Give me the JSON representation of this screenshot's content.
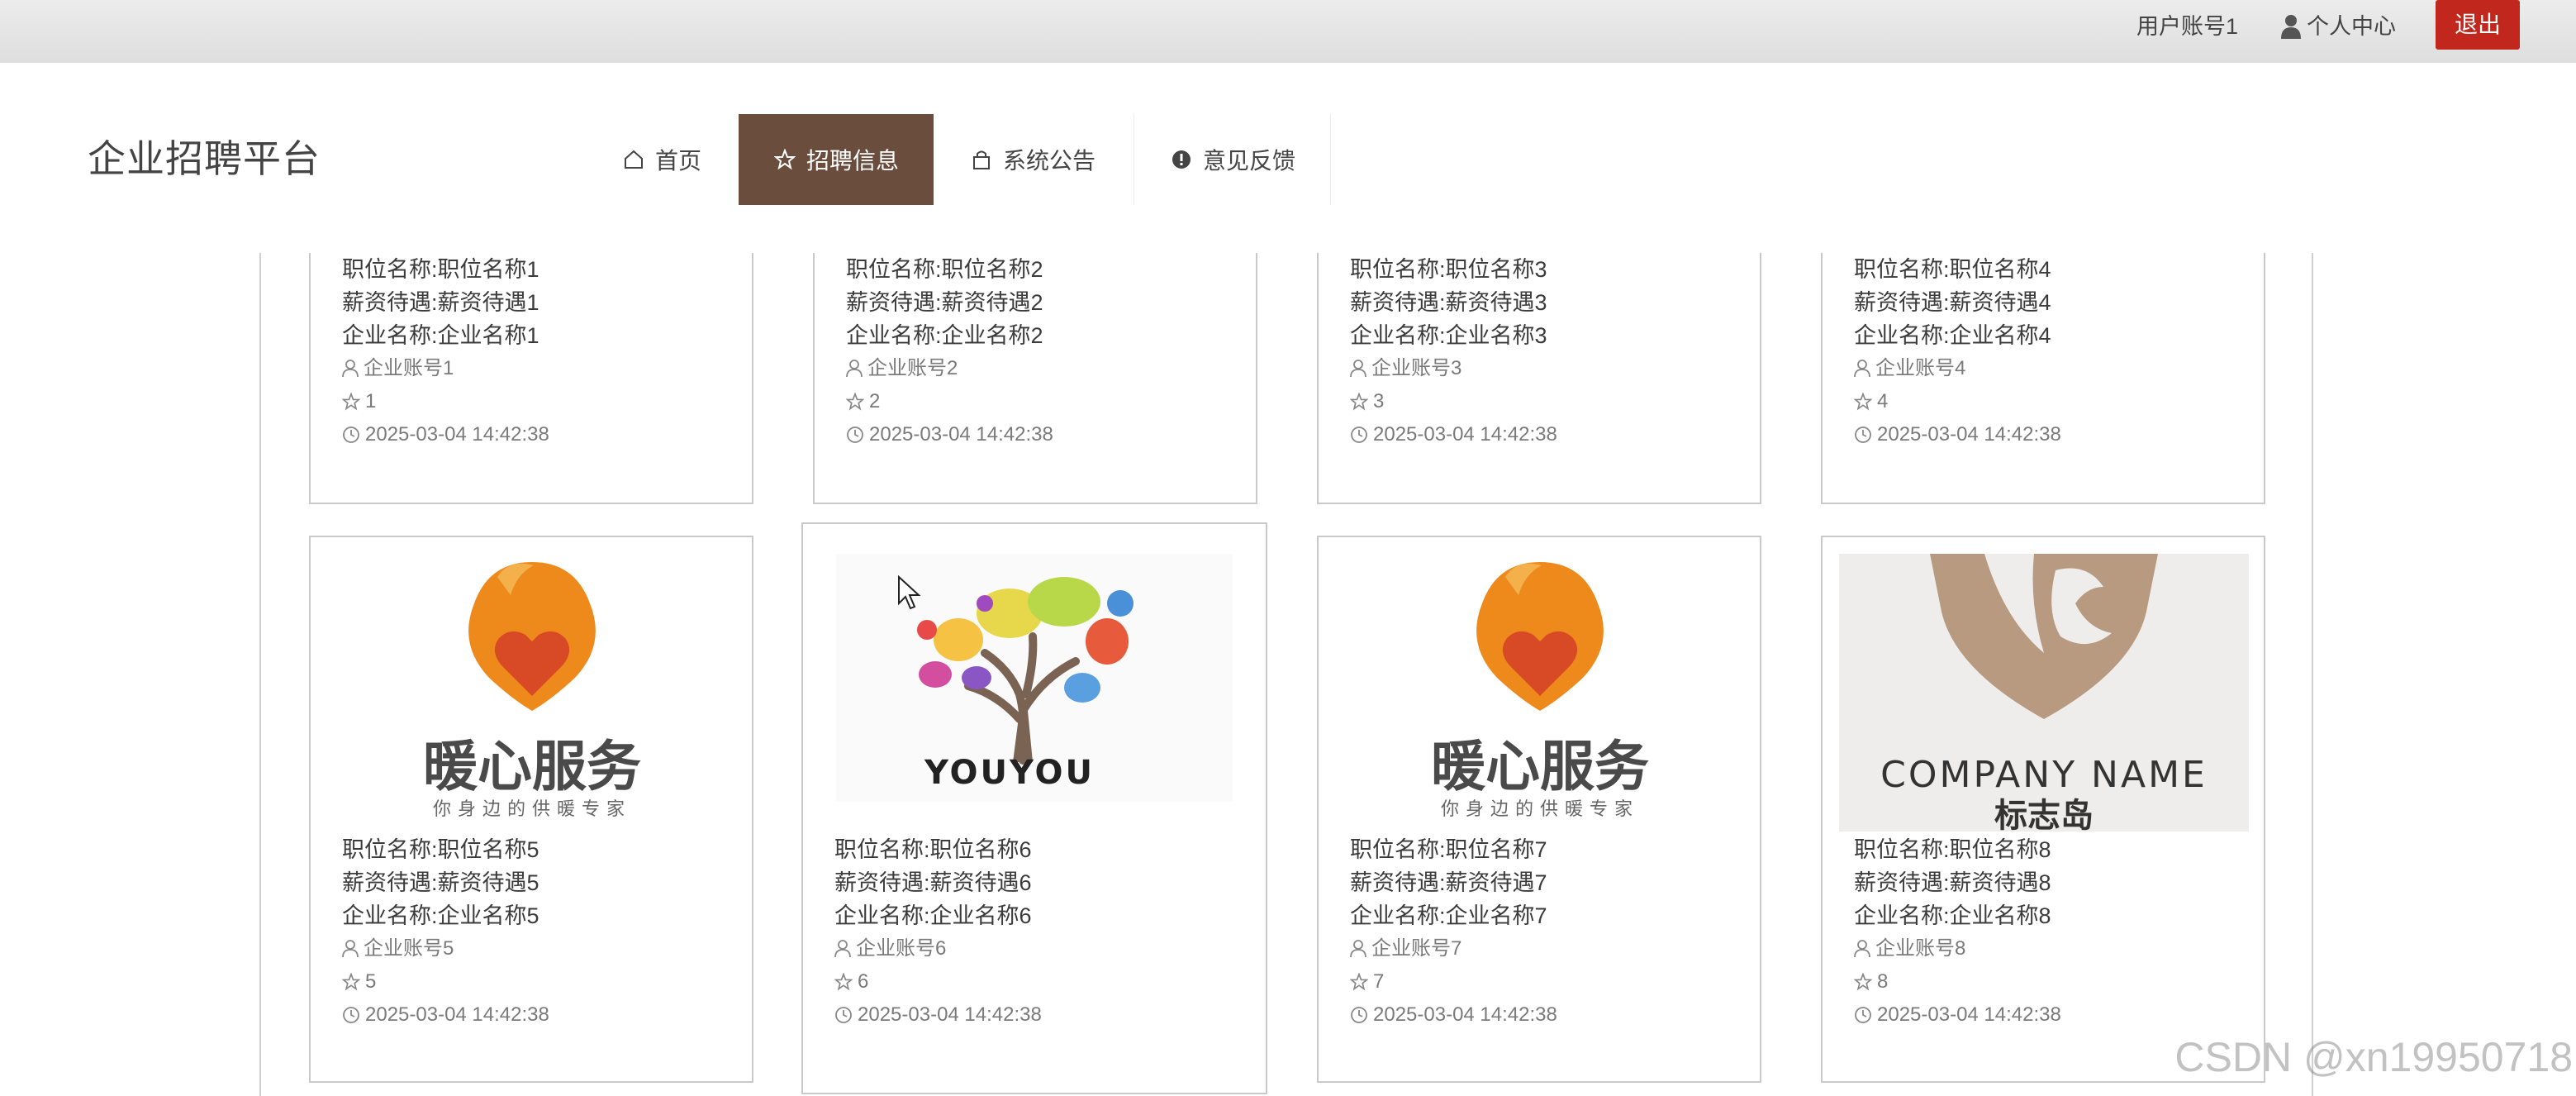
{
  "topbar": {
    "account": "用户账号1",
    "profile": "个人中心",
    "logout": "退出"
  },
  "brand": "企业招聘平台",
  "nav": [
    {
      "label": "首页",
      "icon": "home-icon",
      "active": false
    },
    {
      "label": "招聘信息",
      "icon": "star-icon",
      "active": true
    },
    {
      "label": "系统公告",
      "icon": "bag-icon",
      "active": false
    },
    {
      "label": "意见反馈",
      "icon": "alert-icon",
      "active": false
    }
  ],
  "colors": {
    "accent": "#6b4d3e",
    "logout": "#c1271c"
  },
  "jobs": [
    {
      "title": "职位名称:职位名称1",
      "salary": "薪资待遇:薪资待遇1",
      "company": "企业名称:企业名称1",
      "account": "企业账号1",
      "favorites": "1",
      "time": "2025-03-04 14:42:38"
    },
    {
      "title": "职位名称:职位名称2",
      "salary": "薪资待遇:薪资待遇2",
      "company": "企业名称:企业名称2",
      "account": "企业账号2",
      "favorites": "2",
      "time": "2025-03-04 14:42:38"
    },
    {
      "title": "职位名称:职位名称3",
      "salary": "薪资待遇:薪资待遇3",
      "company": "企业名称:企业名称3",
      "account": "企业账号3",
      "favorites": "3",
      "time": "2025-03-04 14:42:38"
    },
    {
      "title": "职位名称:职位名称4",
      "salary": "薪资待遇:薪资待遇4",
      "company": "企业名称:企业名称4",
      "account": "企业账号4",
      "favorites": "4",
      "time": "2025-03-04 14:42:38"
    },
    {
      "title": "职位名称:职位名称5",
      "salary": "薪资待遇:薪资待遇5",
      "company": "企业名称:企业名称5",
      "account": "企业账号5",
      "favorites": "5",
      "time": "2025-03-04 14:42:38",
      "logo": "nuanxin"
    },
    {
      "title": "职位名称:职位名称6",
      "salary": "薪资待遇:薪资待遇6",
      "company": "企业名称:企业名称6",
      "account": "企业账号6",
      "favorites": "6",
      "time": "2025-03-04 14:42:38",
      "logo": "youyou"
    },
    {
      "title": "职位名称:职位名称7",
      "salary": "薪资待遇:薪资待遇7",
      "company": "企业名称:企业名称7",
      "account": "企业账号7",
      "favorites": "7",
      "time": "2025-03-04 14:42:38",
      "logo": "nuanxin"
    },
    {
      "title": "职位名称:职位名称8",
      "salary": "薪资待遇:薪资待遇8",
      "company": "企业名称:企业名称8",
      "account": "企业账号8",
      "favorites": "8",
      "time": "2025-03-04 14:42:38",
      "logo": "biaozhidao"
    }
  ],
  "logos": {
    "nuanxin": {
      "name": "暖心服务",
      "slogan": "你身边的供暖专家"
    },
    "youyou": {
      "name": "YOUYOU"
    },
    "biaozhidao": {
      "name": "COMPANY NAME",
      "sub": "标志岛"
    }
  },
  "watermark": "CSDN @xn19950718"
}
